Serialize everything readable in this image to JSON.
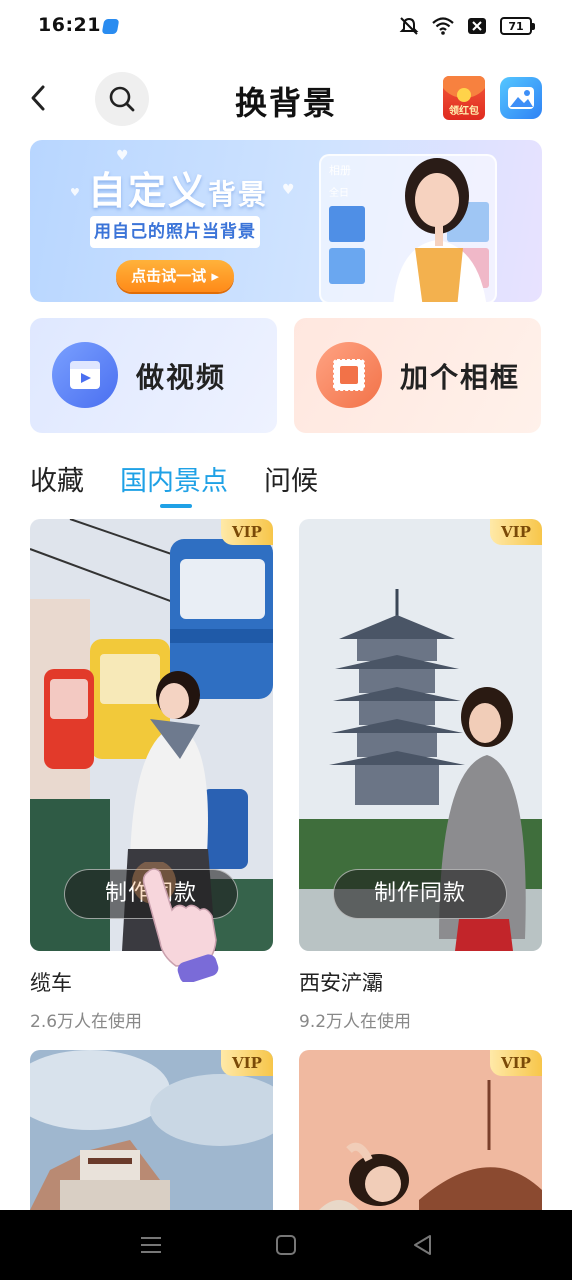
{
  "status_bar": {
    "time": "16:21",
    "battery": "71",
    "icons": [
      "mute-icon",
      "wifi-icon",
      "sim-off-icon",
      "battery-icon"
    ]
  },
  "header": {
    "title": "换背景",
    "red_packet_label": "领红包",
    "icons": [
      "back-icon",
      "search-icon",
      "red-packet-icon",
      "gallery-icon"
    ]
  },
  "banner": {
    "title_main": "自定义",
    "title_sub": "背景",
    "subtitle": "用自己的照片当背景",
    "cta": "点击试一试 ▸",
    "album_label": "相册",
    "album_sub": "全日"
  },
  "actions": [
    {
      "label": "做视频",
      "icon": "video-play-icon"
    },
    {
      "label": "加个相框",
      "icon": "photo-frame-icon"
    }
  ],
  "tabs": [
    {
      "label": "收藏",
      "active": false
    },
    {
      "label": "国内景点",
      "active": true
    },
    {
      "label": "问候",
      "active": false
    }
  ],
  "cards": [
    {
      "title": "缆车",
      "users": "2.6万人在使用",
      "vip": "VIP",
      "button": "制作同款"
    },
    {
      "title": "西安浐灞",
      "users": "9.2万人在使用",
      "vip": "VIP",
      "button": "制作同款"
    },
    {
      "title": "",
      "users": "",
      "vip": "VIP",
      "button": ""
    },
    {
      "title": "",
      "users": "",
      "vip": "VIP",
      "button": ""
    }
  ],
  "colors": {
    "accent": "#1fa1e6",
    "vip_gold": "#f7c64a",
    "cta_orange": "#ff8a18"
  }
}
